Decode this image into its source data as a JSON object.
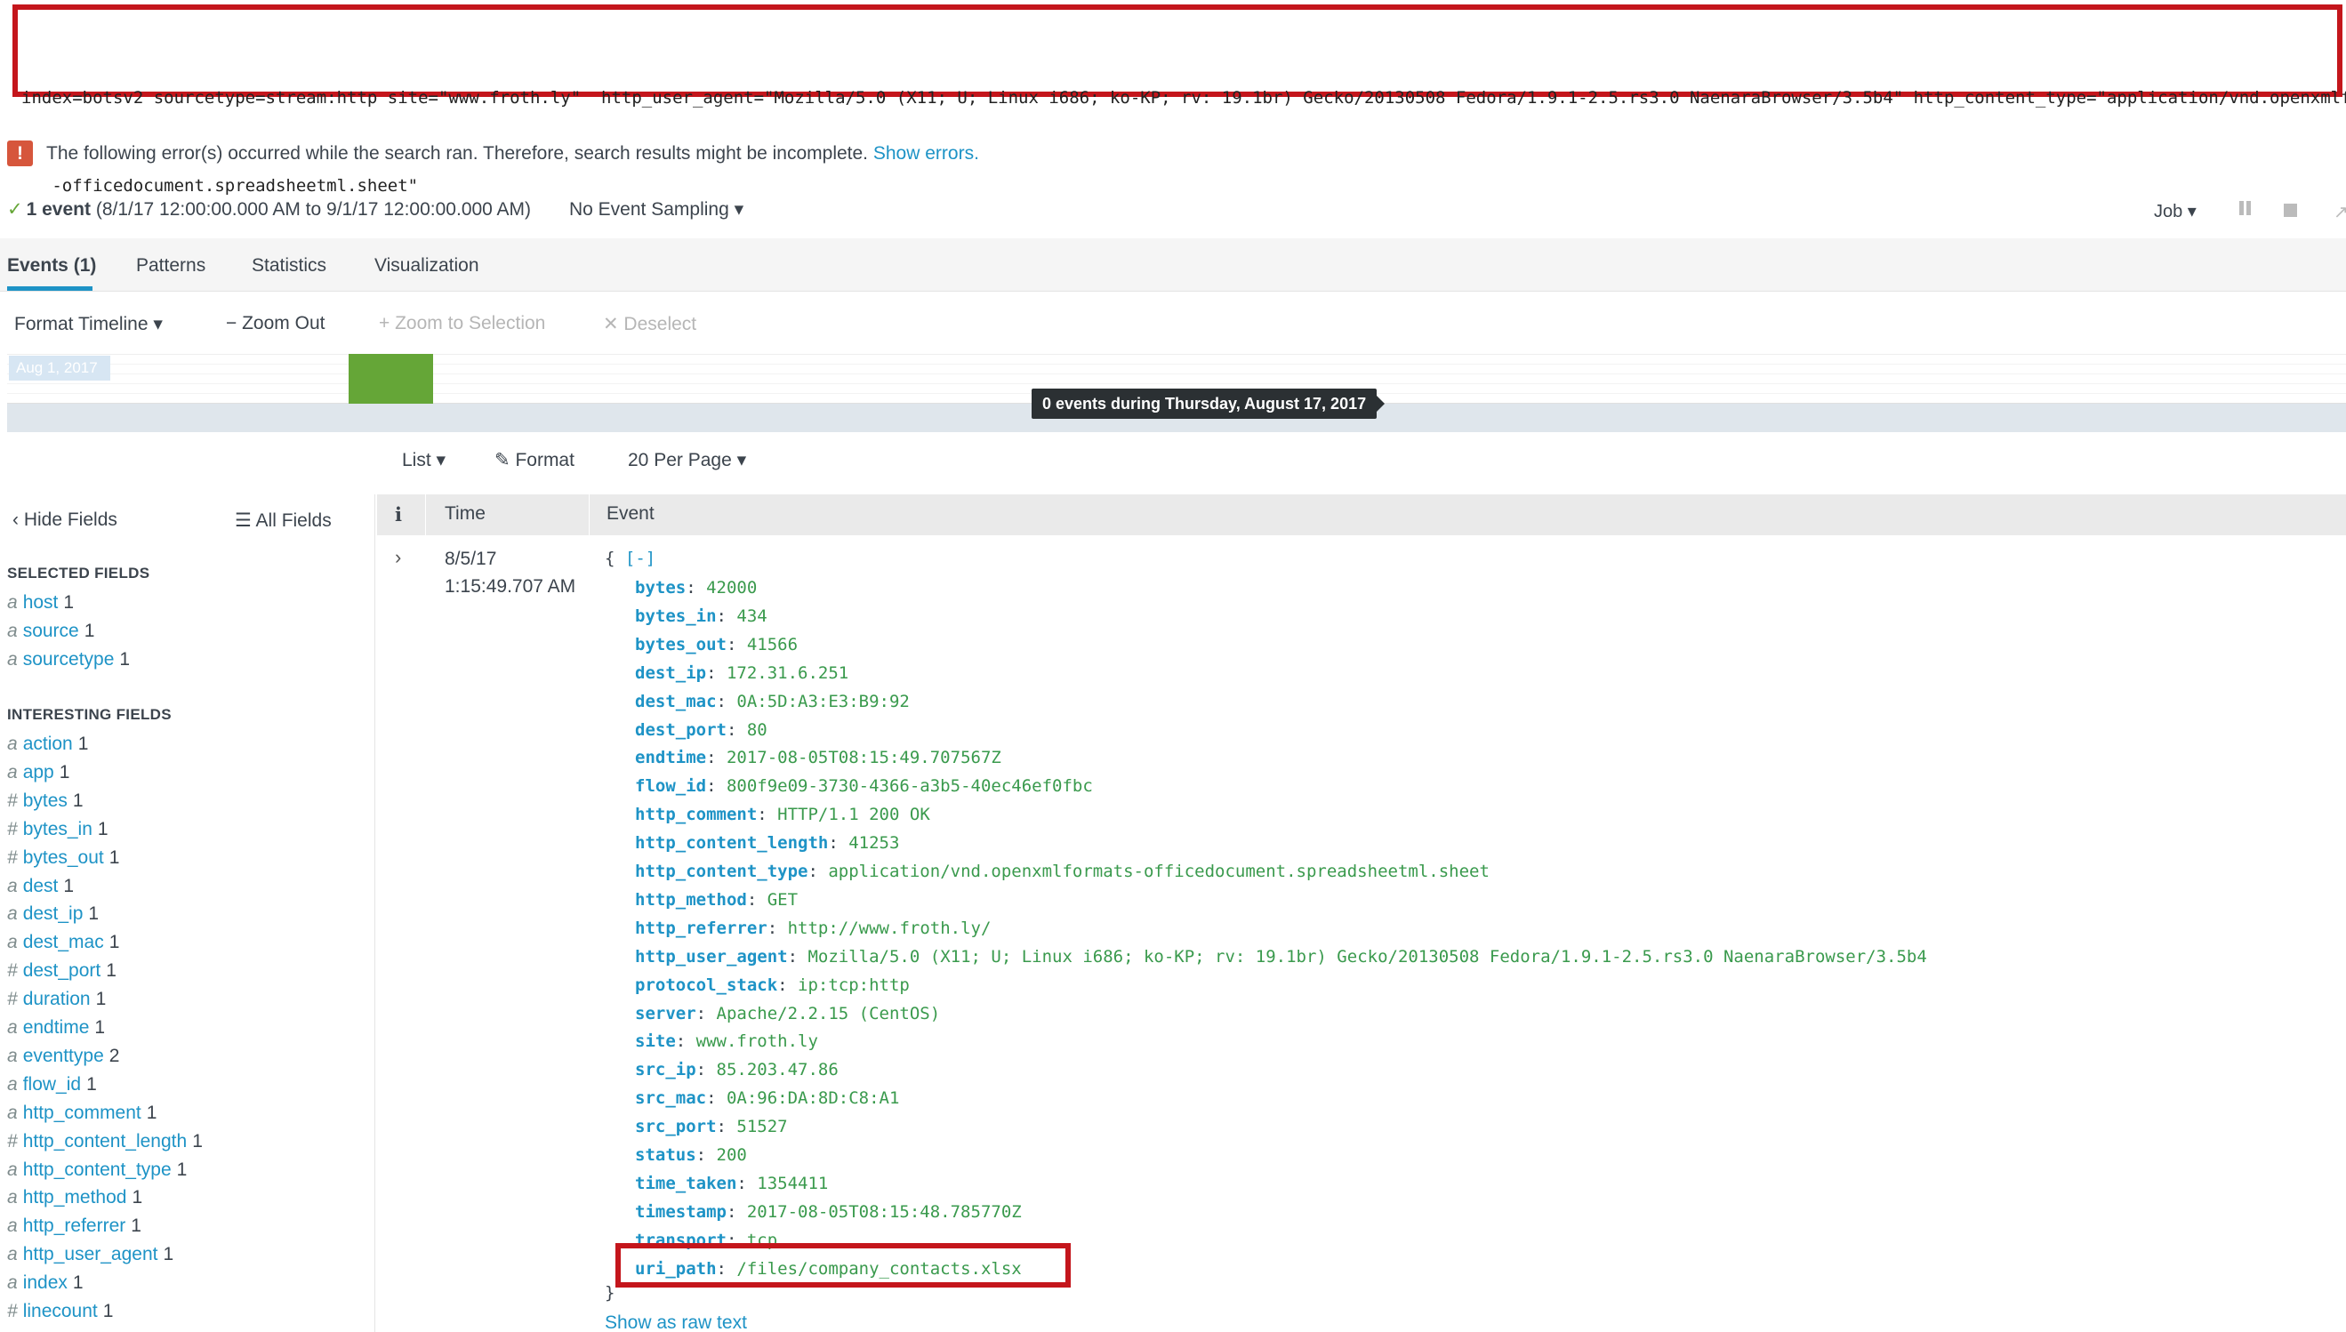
{
  "search": {
    "query_line1": "index=botsv2 sourcetype=stream:http site=\"www.froth.ly\"  http_user_agent=\"Mozilla/5.0 (X11; U; Linux i686; ko-KP; rv: 19.1br) Gecko/20130508 Fedora/1.9.1-2.5.rs3.0 NaenaraBrowser/3.5b4\" http_content_type=\"application/vnd.openxmlformat",
    "query_line2": "   -officedocument.spreadsheetml.sheet\""
  },
  "error": {
    "icon": "!",
    "message": "The following error(s) occurred while the search ran. Therefore, search results might be incomplete.",
    "link": "Show errors."
  },
  "summary": {
    "count": "1 event",
    "range": "(8/1/17 12:00:00.000 AM to 9/1/17 12:00:00.000 AM)",
    "sampling": "No Event Sampling ▾",
    "job": "Job ▾"
  },
  "tabs": [
    "Events (1)",
    "Patterns",
    "Statistics",
    "Visualization"
  ],
  "timeline_controls": {
    "format": "Format Timeline ▾",
    "zoom_out": "− Zoom Out",
    "zoom_sel": "+ Zoom to Selection",
    "deselect": "✕ Deselect"
  },
  "timeline": {
    "start_label": "Aug 1, 2017",
    "tooltip": "0 events during Thursday, August 17, 2017"
  },
  "results_controls": {
    "list": "List ▾",
    "format": "Format",
    "per_page": "20 Per Page ▾"
  },
  "sidebar": {
    "hide_fields": "Hide Fields",
    "all_fields": "All Fields",
    "selected_header": "SELECTED FIELDS",
    "selected": [
      {
        "type": "a",
        "name": "host",
        "count": "1"
      },
      {
        "type": "a",
        "name": "source",
        "count": "1"
      },
      {
        "type": "a",
        "name": "sourcetype",
        "count": "1"
      }
    ],
    "interesting_header": "INTERESTING FIELDS",
    "interesting": [
      {
        "type": "a",
        "name": "action",
        "count": "1"
      },
      {
        "type": "a",
        "name": "app",
        "count": "1"
      },
      {
        "type": "#",
        "name": "bytes",
        "count": "1"
      },
      {
        "type": "#",
        "name": "bytes_in",
        "count": "1"
      },
      {
        "type": "#",
        "name": "bytes_out",
        "count": "1"
      },
      {
        "type": "a",
        "name": "dest",
        "count": "1"
      },
      {
        "type": "a",
        "name": "dest_ip",
        "count": "1"
      },
      {
        "type": "a",
        "name": "dest_mac",
        "count": "1"
      },
      {
        "type": "#",
        "name": "dest_port",
        "count": "1"
      },
      {
        "type": "#",
        "name": "duration",
        "count": "1"
      },
      {
        "type": "a",
        "name": "endtime",
        "count": "1"
      },
      {
        "type": "a",
        "name": "eventtype",
        "count": "2"
      },
      {
        "type": "a",
        "name": "flow_id",
        "count": "1"
      },
      {
        "type": "a",
        "name": "http_comment",
        "count": "1"
      },
      {
        "type": "#",
        "name": "http_content_length",
        "count": "1"
      },
      {
        "type": "a",
        "name": "http_content_type",
        "count": "1"
      },
      {
        "type": "a",
        "name": "http_method",
        "count": "1"
      },
      {
        "type": "a",
        "name": "http_referrer",
        "count": "1"
      },
      {
        "type": "a",
        "name": "http_user_agent",
        "count": "1"
      },
      {
        "type": "a",
        "name": "index",
        "count": "1"
      },
      {
        "type": "#",
        "name": "linecount",
        "count": "1"
      }
    ]
  },
  "table": {
    "col_info": "i",
    "col_time": "Time",
    "col_event": "Event"
  },
  "event": {
    "date": "8/5/17",
    "time": "1:15:49.707 AM",
    "open": "{ ",
    "collapse": "[-]",
    "close": "}",
    "raw_link": "Show as raw text",
    "fields": [
      {
        "k": "bytes",
        "v": "42000"
      },
      {
        "k": "bytes_in",
        "v": "434"
      },
      {
        "k": "bytes_out",
        "v": "41566"
      },
      {
        "k": "dest_ip",
        "v": "172.31.6.251"
      },
      {
        "k": "dest_mac",
        "v": "0A:5D:A3:E3:B9:92"
      },
      {
        "k": "dest_port",
        "v": "80"
      },
      {
        "k": "endtime",
        "v": "2017-08-05T08:15:49.707567Z"
      },
      {
        "k": "flow_id",
        "v": "800f9e09-3730-4366-a3b5-40ec46ef0fbc"
      },
      {
        "k": "http_comment",
        "v": "HTTP/1.1 200 OK"
      },
      {
        "k": "http_content_length",
        "v": "41253"
      },
      {
        "k": "http_content_type",
        "v": "application/vnd.openxmlformats-officedocument.spreadsheetml.sheet"
      },
      {
        "k": "http_method",
        "v": "GET"
      },
      {
        "k": "http_referrer",
        "v": "http://www.froth.ly/"
      },
      {
        "k": "http_user_agent",
        "v": "Mozilla/5.0 (X11; U; Linux i686; ko-KP; rv: 19.1br) Gecko/20130508 Fedora/1.9.1-2.5.rs3.0 NaenaraBrowser/3.5b4"
      },
      {
        "k": "protocol_stack",
        "v": "ip:tcp:http"
      },
      {
        "k": "server",
        "v": "Apache/2.2.15 (CentOS)"
      },
      {
        "k": "site",
        "v": "www.froth.ly"
      },
      {
        "k": "src_ip",
        "v": "85.203.47.86"
      },
      {
        "k": "src_mac",
        "v": "0A:96:DA:8D:C8:A1"
      },
      {
        "k": "src_port",
        "v": "51527"
      },
      {
        "k": "status",
        "v": "200"
      },
      {
        "k": "time_taken",
        "v": "1354411"
      },
      {
        "k": "timestamp",
        "v": "2017-08-05T08:15:48.785770Z"
      },
      {
        "k": "transport",
        "v": "tcp"
      },
      {
        "k": "uri_path",
        "v": "/files/company_contacts.xlsx"
      }
    ]
  },
  "colors": {
    "highlight_box": "#c4161c",
    "link": "#1e93c6",
    "value_green": "#3a9a4d",
    "timeline_bar": "#65a637"
  }
}
